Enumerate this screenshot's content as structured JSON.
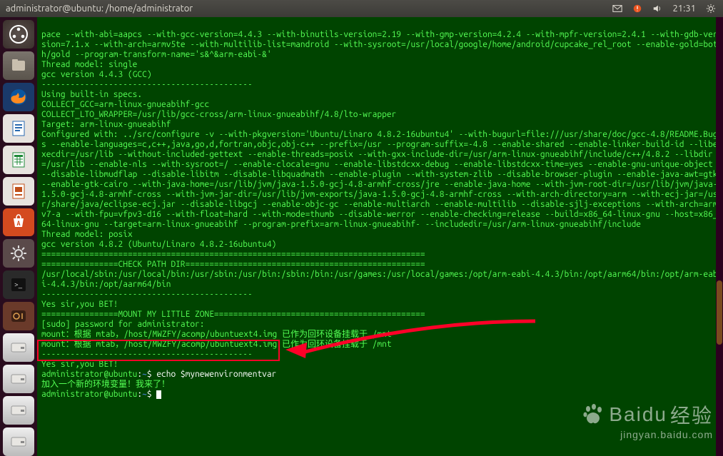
{
  "titlebar": {
    "title": "administrator@ubuntu: /home/administrator",
    "time": "21:31"
  },
  "launcher": {
    "items": [
      {
        "name": "dash",
        "tip": "Dash"
      },
      {
        "name": "files",
        "tip": "Files"
      },
      {
        "name": "firefox",
        "tip": "Firefox"
      },
      {
        "name": "writer",
        "tip": "LibreOffice Writer"
      },
      {
        "name": "calc",
        "tip": "LibreOffice Calc"
      },
      {
        "name": "impress",
        "tip": "LibreOffice Impress"
      },
      {
        "name": "software",
        "tip": "Ubuntu Software Center"
      },
      {
        "name": "settings",
        "tip": "System Settings"
      },
      {
        "name": "terminal",
        "tip": "Terminal"
      },
      {
        "name": "media",
        "tip": "Media"
      },
      {
        "name": "disk1",
        "tip": "Volume"
      },
      {
        "name": "disk2",
        "tip": "Volume"
      },
      {
        "name": "disk3",
        "tip": "Volume"
      },
      {
        "name": "disk4",
        "tip": "Volume"
      }
    ]
  },
  "terminal": {
    "block1": "pace --with-abi=aapcs --with-gcc-version=4.4.3 --with-binutils-version=2.19 --with-gmp-version=4.2.4 --with-mpfr-version=2.4.1 --with-gdb-version=7.1.x --with-arch=armv5te --with-multilib-list=mandroid --with-sysroot=/usr/local/google/home/android/cupcake_rel_root --enable-gold=both/gold --program-transform-name='s&^&arm-eabi-&'",
    "thread1": "Thread model: single",
    "gcc1": "gcc version 4.4.3 (GCC)",
    "sep1": "--------------------------------------------",
    "using": "Using built-in specs.",
    "collect_gcc": "COLLECT_GCC=arm-linux-gnueabihf-gcc",
    "collect_lto": "COLLECT_LTO_WRAPPER=/usr/lib/gcc-cross/arm-linux-gnueabihf/4.8/lto-wrapper",
    "target": "Target: arm-linux-gnueabihf",
    "configured": "Configured with: ../src/configure -v --with-pkgversion='Ubuntu/Linaro 4.8.2-16ubuntu4' --with-bugurl=file:///usr/share/doc/gcc-4.8/README.Bugs --enable-languages=c,c++,java,go,d,fortran,objc,obj-c++ --prefix=/usr --program-suffix=-4.8 --enable-shared --enable-linker-build-id --libexecdir=/usr/lib --without-included-gettext --enable-threads=posix --with-gxx-include-dir=/usr/arm-linux-gnueabihf/include/c++/4.8.2 --libdir=/usr/lib --enable-nls --with-sysroot=/ --enable-clocale=gnu --enable-libstdcxx-debug --enable-libstdcxx-time=yes --enable-gnu-unique-object --disable-libmudflap --disable-libitm --disable-libquadmath --enable-plugin --with-system-zlib --disable-browser-plugin --enable-java-awt=gtk --enable-gtk-cairo --with-java-home=/usr/lib/jvm/java-1.5.0-gcj-4.8-armhf-cross/jre --enable-java-home --with-jvm-root-dir=/usr/lib/jvm/java-1.5.0-gcj-4.8-armhf-cross --with-jvm-jar-dir=/usr/lib/jvm-exports/java-1.5.0-gcj-4.8-armhf-cross --with-arch-directory=arm --with-ecj-jar=/usr/share/java/eclipse-ecj.jar --disable-libgcj --enable-objc-gc --enable-multiarch --enable-multilib --disable-sjlj-exceptions --with-arch=armv7-a --with-fpu=vfpv3-d16 --with-float=hard --with-mode=thumb --disable-werror --enable-checking=release --build=x86_64-linux-gnu --host=x86_64-linux-gnu --target=arm-linux-gnueabihf --program-prefix=arm-linux-gnueabihf- --includedir=/usr/arm-linux-gnueabihf/include",
    "thread2": "Thread model: posix",
    "gcc2": "gcc version 4.8.2 (Ubuntu/Linaro 4.8.2-16ubuntu4)",
    "eq1": "================================================================================",
    "checkpath": "================CHECK PATH DIR==================================================",
    "path": "/usr/local/sbin:/usr/local/bin:/usr/sbin:/usr/bin:/sbin:/bin:/usr/games:/usr/local/games:/opt/arm-eabi-4.4.3/bin:/opt/aarm64/bin:/opt/arm-eabi-4.4.3/bin:/opt/aarm64/bin",
    "sep2": "--------------------------------------------",
    "yes1": "Yes sir,you BET!",
    "mount_hdr": "================MOUNT MY LITTLE ZONE============================================",
    "sudo": "[sudo] password for administrator:",
    "mount1": "mount：根据 mtab，/host/MWZFY/acomp/ubuntuext4.img 已作为回环设备挂载于 /mnt",
    "mount2": "mount：根据 mtab，/host/MWZFY/acomp/ubuntuext4.img 已作为回环设备挂载于 /mnt",
    "sep3": "--------------------------------------------",
    "yes2": "Yes sir,you BET!",
    "prompt1_user": "administrator@ubuntu",
    "prompt1_path": "~",
    "cmd1": "echo $mynewenvironmentvar",
    "out1": "加入一个新的环境变量！我来了！",
    "prompt2_user": "administrator@ubuntu",
    "prompt2_path": "~"
  },
  "watermark": {
    "brand_cn": "经验",
    "brand_en": "Baidu",
    "url": "jingyan.baidu.com"
  }
}
